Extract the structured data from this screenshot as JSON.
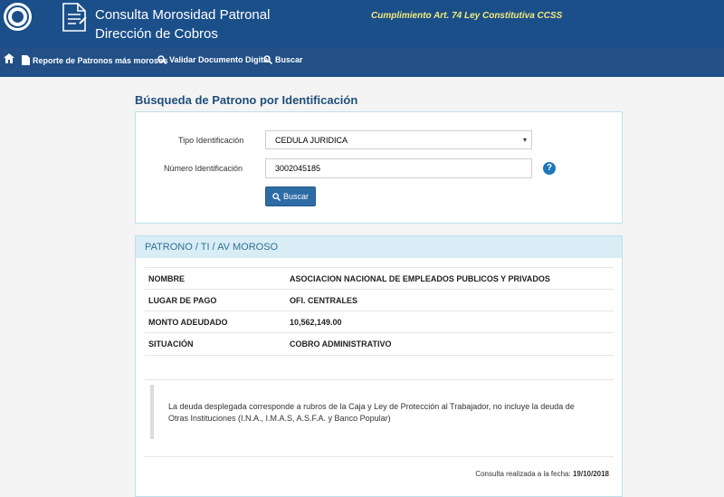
{
  "header": {
    "title_line1": "Consulta Morosidad Patronal",
    "title_line2": "Dirección de Cobros",
    "law_text": "Cumplimiento Art. 74 Ley Constitutiva CCSS",
    "logo_icon": "ccss-seal-logo",
    "doc_icon": "document-icon"
  },
  "nav": {
    "home_icon": "home-icon",
    "report_label": "Reporte de Patronos más morosos",
    "validate_label": "Validar Documento Digital",
    "search_label": "Buscar"
  },
  "search": {
    "section_title": "Búsqueda de Patrono por Identificación",
    "tipo_label": "Tipo Identificación",
    "tipo_value": "CEDULA JURIDICA",
    "numero_label": "Número Identificación",
    "numero_value": "3002045185",
    "help_symbol": "?",
    "button_label": "Buscar"
  },
  "result": {
    "panel_title": "PATRONO / TI / AV MOROSO",
    "rows": [
      {
        "key": "NOMBRE",
        "value": "ASOCIACION NACIONAL DE EMPLEADOS PUBLICOS Y PRIVADOS"
      },
      {
        "key": "LUGAR DE PAGO",
        "value": "OFI. CENTRALES"
      },
      {
        "key": "MONTO ADEUDADO",
        "value": "10,562,149.00"
      },
      {
        "key": "SITUACIÓN",
        "value": "COBRO ADMINISTRATIVO"
      }
    ],
    "note_line1": "La deuda desplegada corresponde a rubros de la Caja y Ley de Protección al Trabajador, no incluye la deuda de",
    "note_line2": "Otras Instituciones (I.N.A., I.M.A.S, A.S.F.A. y Banco Popular)",
    "date_label": "Consulta realizada a la fecha:",
    "date_value": "19/10/2018"
  }
}
